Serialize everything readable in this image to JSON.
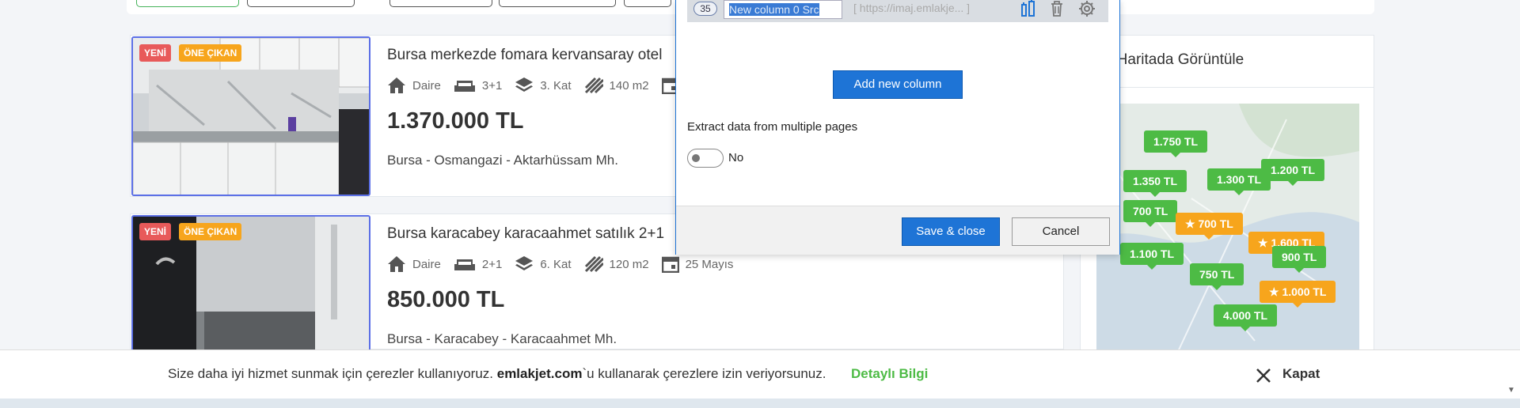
{
  "listings": [
    {
      "badges": {
        "new": "YENİ",
        "featured": "ÖNE ÇIKAN"
      },
      "title": "Bursa merkezde fomara kervansaray otel",
      "features": {
        "type": "Daire",
        "rooms": "3+1",
        "floor": "3. Kat",
        "area": "140 m2"
      },
      "price": "1.370.000 TL",
      "location": "Bursa - Osmangazi - Aktarhüssam Mh."
    },
    {
      "badges": {
        "new": "YENİ",
        "featured": "ÖNE ÇIKAN"
      },
      "title": "Bursa karacabey karacaahmet satılık 2+1",
      "features": {
        "type": "Daire",
        "rooms": "2+1",
        "floor": "6. Kat",
        "area": "120 m2",
        "date": "25 Mayıs"
      },
      "price": "850.000 TL",
      "location": "Bursa - Karacabey - Karacaahmet Mh."
    }
  ],
  "map": {
    "title": "ları Haritada Görüntüle",
    "pins": [
      {
        "label": "1.750 TL",
        "color": "green"
      },
      {
        "label": "1.350 TL",
        "color": "green"
      },
      {
        "label": "1.300 TL",
        "color": "green"
      },
      {
        "label": "1.200 TL",
        "color": "green"
      },
      {
        "label": "700 TL",
        "color": "green"
      },
      {
        "label": "700 TL",
        "color": "orange",
        "star": true
      },
      {
        "label": "1.600 TL",
        "color": "orange",
        "star": true
      },
      {
        "label": "1.100 TL",
        "color": "green"
      },
      {
        "label": "900 TL",
        "color": "green"
      },
      {
        "label": "750 TL",
        "color": "green"
      },
      {
        "label": "1.000 TL",
        "color": "orange",
        "star": true
      },
      {
        "label": "4.000 TL",
        "color": "green"
      }
    ]
  },
  "dialog": {
    "column": {
      "number": "35",
      "name": "New column 0 Src",
      "url_placeholder": "[ https://imaj.emlakje... ]"
    },
    "add_column_label": "Add new column",
    "extract_label": "Extract data from multiple pages",
    "toggle_label": "No",
    "save_label": "Save & close",
    "cancel_label": "Cancel"
  },
  "cookie": {
    "text_before": "Size daha iyi hizmet sunmak için çerezler kullanıyoruz. ",
    "site": "emlakjet.com",
    "text_after": "`u kullanarak çerezlere izin veriyorsunuz.",
    "more_label": "Detaylı Bilgi",
    "close_label": "Kapat"
  },
  "colors": {
    "accent_blue": "#1e74d6",
    "green": "#4dbb45",
    "orange": "#f7a51c",
    "badge_red": "#e85a5a"
  }
}
